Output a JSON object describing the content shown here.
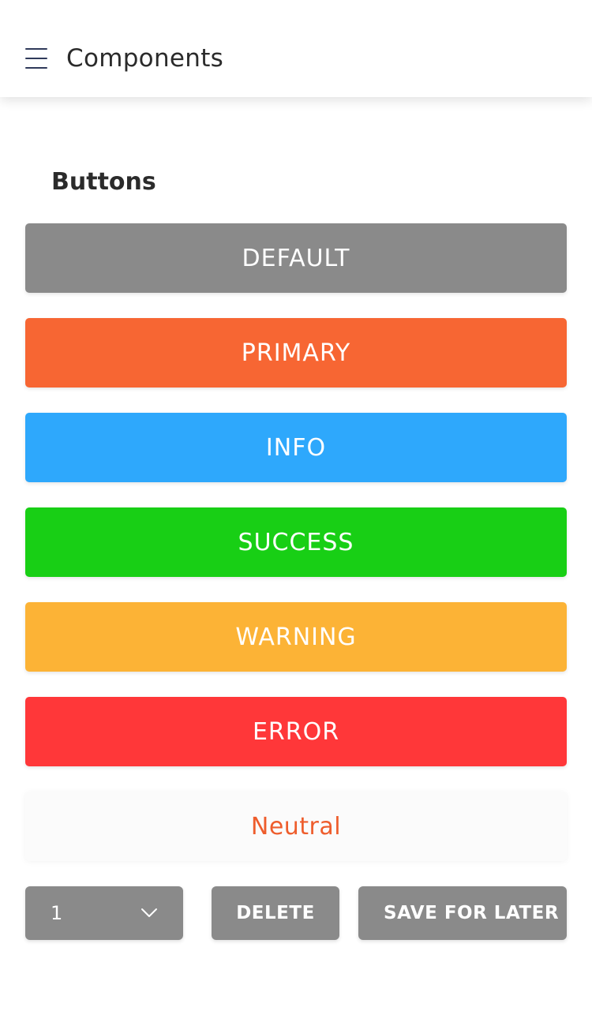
{
  "header": {
    "title": "Components",
    "menu_icon": "hamburger-menu-icon"
  },
  "section": {
    "title": "Buttons"
  },
  "buttons": [
    {
      "label": "DEFAULT",
      "color": "#8a8a8a"
    },
    {
      "label": "PRIMARY",
      "color": "#f76633"
    },
    {
      "label": "INFO",
      "color": "#2ea8fc"
    },
    {
      "label": "SUCCESS",
      "color": "#18cf15"
    },
    {
      "label": "WARNING",
      "color": "#fcb336"
    },
    {
      "label": "ERROR",
      "color": "#ff3739"
    },
    {
      "label": "Neutral",
      "color": "#ee5d2c"
    }
  ],
  "bottom_row": {
    "select_value": "1",
    "select_icon": "chevron-down-icon",
    "delete_label": "DELETE",
    "save_label": "SAVE FOR LATER",
    "color": "#8a8a8a"
  }
}
